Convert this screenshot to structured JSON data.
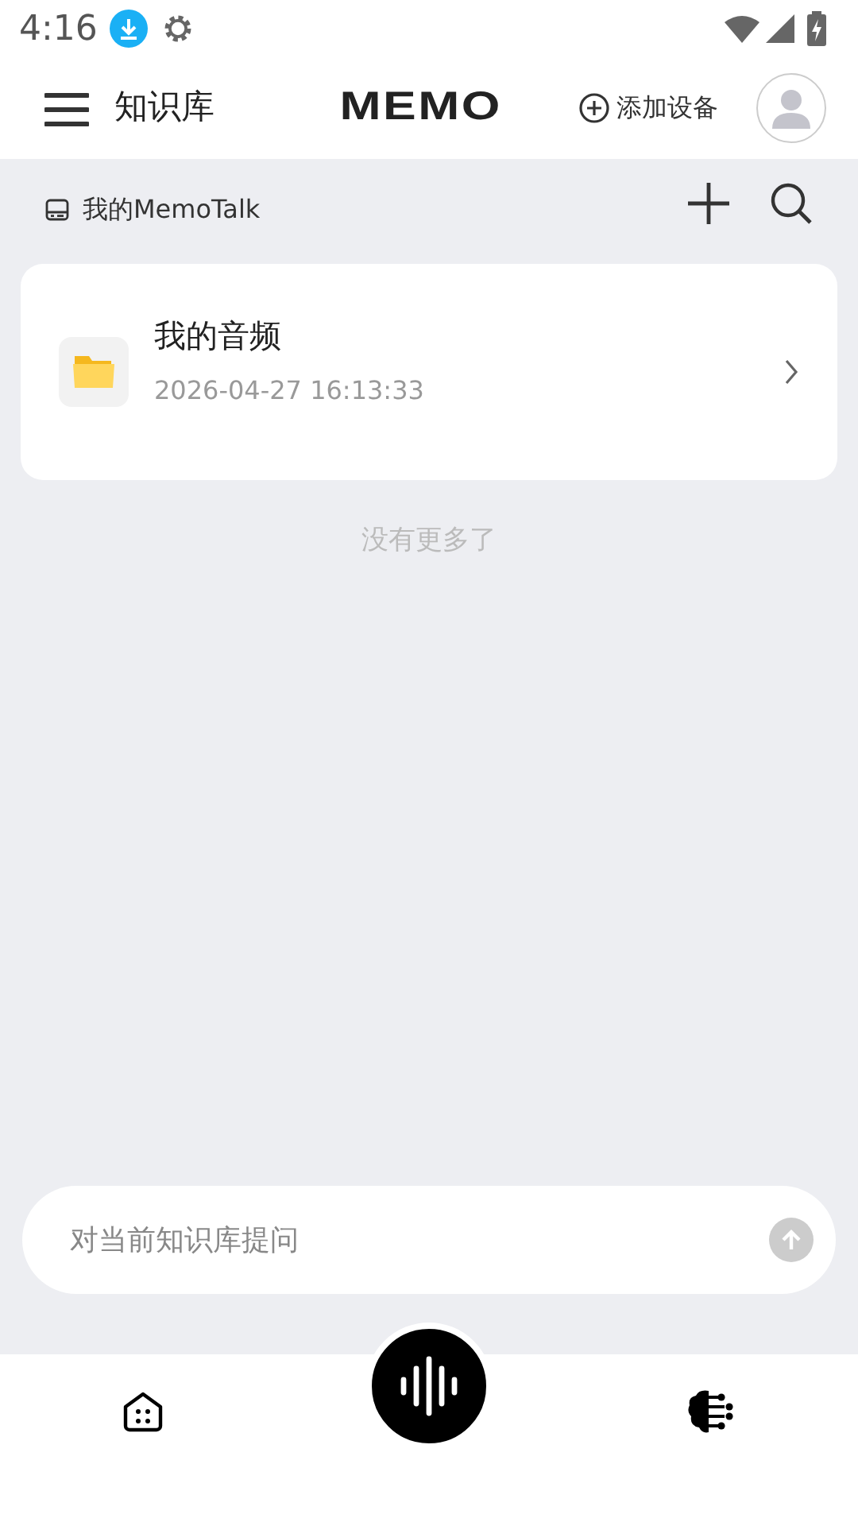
{
  "status_bar": {
    "time": "4:16"
  },
  "header": {
    "title": "知识库",
    "logo": "MEMO",
    "add_device": "添加设备"
  },
  "toolbar": {
    "library": "我的MemoTalk"
  },
  "folders": [
    {
      "name": "我的音频",
      "date": "2026-04-27 16:13:33"
    }
  ],
  "end_note": "没有更多了",
  "ask": {
    "placeholder": "对当前知识库提问"
  }
}
